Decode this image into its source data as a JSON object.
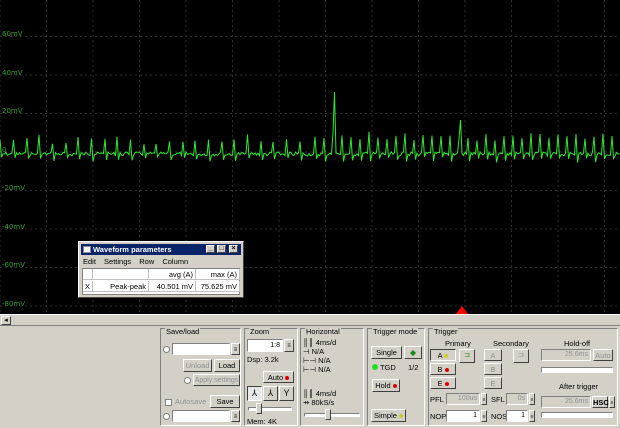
{
  "scope": {
    "y_labels": [
      "60mV",
      "40mV",
      "20mV",
      "0",
      "-20mV",
      "-40mV",
      "-60mV",
      "-80mV"
    ],
    "grid_color": "#303030",
    "trace_color": "#2ee62e",
    "marker_color": "#ff0000"
  },
  "waveform_window": {
    "title": "Waveform parameters",
    "menu": [
      "Edit",
      "Settings",
      "Row",
      "Column"
    ],
    "columns": [
      "avg (A)",
      "max (A)"
    ],
    "rows": [
      {
        "marker": "X",
        "name": "Peak-peak",
        "avg": "40.501 mV",
        "max": "75.625 mV"
      }
    ]
  },
  "save_load": {
    "title": "Save/load",
    "unload": "Unload",
    "load": "Load",
    "apply_settings": "Apply settings",
    "autosave": "Autosave",
    "save": "Save"
  },
  "zoom": {
    "title": "Zoom",
    "value": "1:8",
    "dsp": "Dsp: 3.2k",
    "auto": "Auto",
    "mem": "Mem: 4K"
  },
  "horizontal": {
    "title": "Horizontal",
    "rows_top": [
      "4ms/d",
      "N/A",
      "N/A",
      "N/A"
    ],
    "rows_bottom": [
      "4ms/d",
      "80kS/s"
    ]
  },
  "trigger_mode": {
    "title": "Trigger mode",
    "single": "Single",
    "tgd": "TGD",
    "ratio": "1/2",
    "hold": "Hold",
    "simple": "Simple"
  },
  "trigger": {
    "title": "Trigger",
    "primary": "Primary",
    "secondary": "Secondary",
    "holdoff": "Hold-off",
    "holdoff_value": "25.6ms",
    "holdoff_auto": "Auto",
    "channels": [
      "A",
      "B",
      "E"
    ],
    "pfl": "PFL",
    "pfl_value": "100us",
    "sfl": "SFL",
    "sfl_value": "0s",
    "nop": "NOP",
    "nop_value": "1",
    "nos": "NOS",
    "nos_value": "1",
    "after_trigger": "After trigger",
    "after_value": "25.6ms",
    "hsc": "HSC"
  }
}
